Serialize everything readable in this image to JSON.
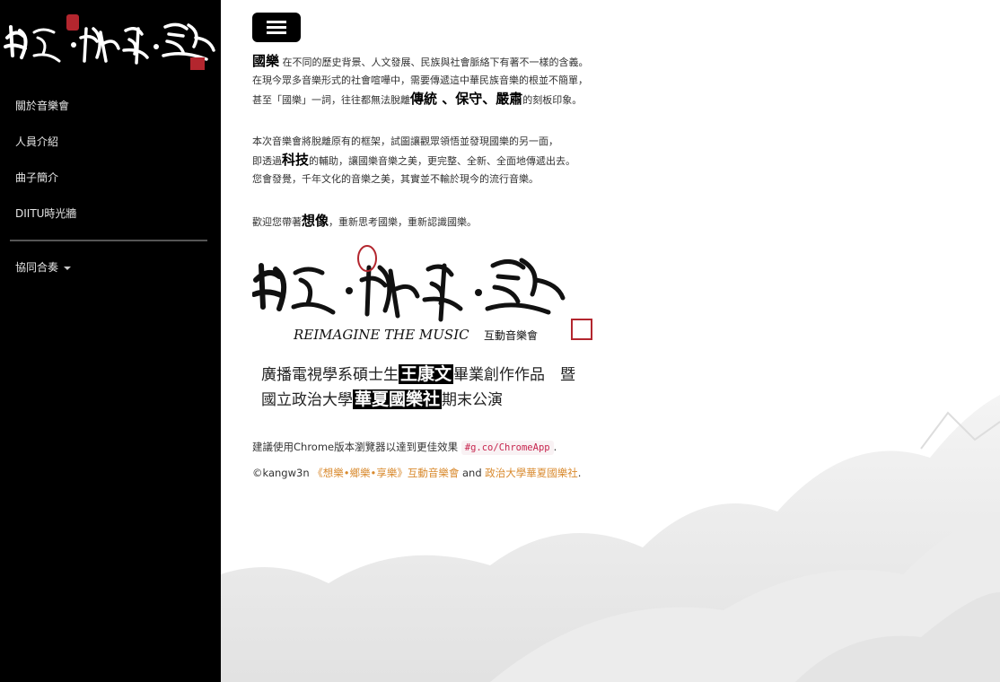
{
  "sidebar": {
    "logo_text": "想樂・鄉樂・享樂",
    "items": [
      {
        "label": "關於音樂會"
      },
      {
        "label": "人員介紹"
      },
      {
        "label": "曲子簡介"
      },
      {
        "label": "DIITU時光牆"
      }
    ],
    "dropdown_label": "協同合奏"
  },
  "intro": {
    "line1_bold": "國樂",
    "line1_rest": " 在不同的歷史背景、人文發展、民族與社會脈絡下有著不一樣的含義。",
    "line2": "在現今眾多音樂形式的社會喧嘩中，需要傳遞這中華民族音樂的根並不簡單，",
    "line3_pre": "甚至「國樂」一詞，往往都無法脫離",
    "line3_b1": "傳統",
    "line3_sep1": " 、",
    "line3_b2": "保守",
    "line3_sep2": "、",
    "line3_b3": "嚴肅",
    "line3_post": "的刻板印象。"
  },
  "concert": {
    "line1": "本次音樂會將脫離原有的框架，試圖讓觀眾領悟並發現國樂的另一面，",
    "line2_pre": "即透過",
    "line2_bold": "科技",
    "line2_post": "的輔助，讓國樂音樂之美，更完整、全新、全面地傳遞出去。",
    "line3": "您會發覺，千年文化的音樂之美，其實並不輸於現今的流行音樂。"
  },
  "welcome": {
    "pre": "歡迎您帶著",
    "bold": "想像",
    "post": "，重新思考國樂，重新認識國樂。"
  },
  "banner": {
    "calligraphy": "想樂・鄉樂・享樂",
    "subtitle": "REIMAGINE THE MUSIC",
    "subtitle_cn": "互動音樂會"
  },
  "credit": {
    "line1_pre": "廣播電視學系碩士生",
    "line1_name": "王康文",
    "line1_post": "畢業創作作品　暨",
    "line2_pre": "國立政治大學",
    "line2_club": "華夏國樂社",
    "line2_post": "期末公演"
  },
  "footer": {
    "browser_note": "建議使用Chrome版本瀏覽器以達到更佳效果",
    "browser_code": "#g.co/ChromeApp",
    "browser_end": ".",
    "copyright_pre": "©kangw3n ",
    "link1": "《想樂•鄉樂•享樂》互動音樂會",
    "and": " and ",
    "link2": "政治大學華夏國樂社",
    "end": "."
  },
  "colors": {
    "sidebar_bg": "#000000",
    "link": "#d98a2e",
    "code": "#c7254e",
    "seal": "#b3262e"
  },
  "icons": [
    "hamburger-menu-icon",
    "caret-down-icon",
    "seal-stamp-icon"
  ]
}
